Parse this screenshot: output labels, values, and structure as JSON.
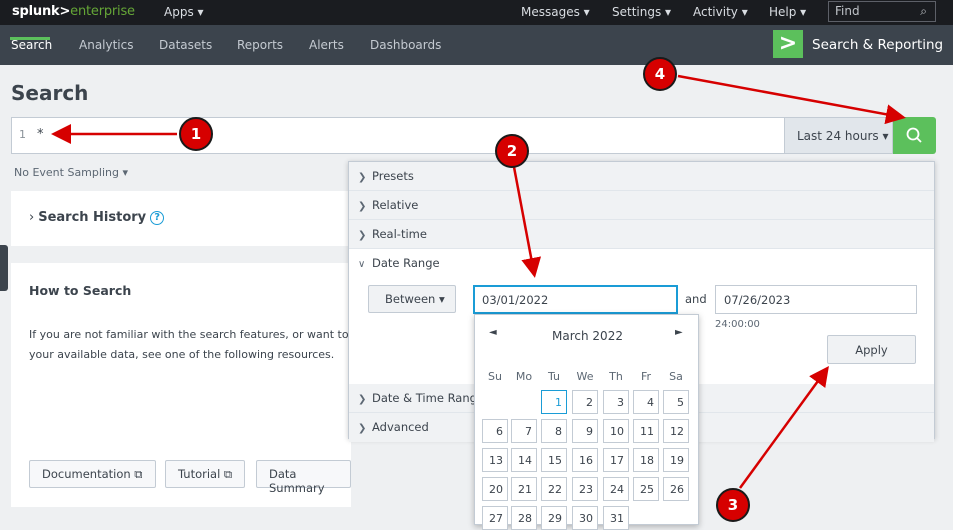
{
  "topbar": {
    "brand_main": "splunk>",
    "brand_sub": "enterprise",
    "apps": "Apps ▾",
    "messages": "Messages ▾",
    "settings": "Settings ▾",
    "activity": "Activity ▾",
    "help": "Help ▾",
    "find_placeholder": "Find"
  },
  "nav": {
    "items": [
      {
        "label": "Search"
      },
      {
        "label": "Analytics"
      },
      {
        "label": "Datasets"
      },
      {
        "label": "Reports"
      },
      {
        "label": "Alerts"
      },
      {
        "label": "Dashboards"
      }
    ],
    "app_name": "Search & Reporting"
  },
  "page": {
    "title": "Search",
    "line_number": "1",
    "query": "*",
    "time_range": "Last 24 hours ▾",
    "sampling": "No Event Sampling ▾",
    "history": "Search History",
    "howto_title": "How to Search",
    "howto_line1": "If you are not familiar with the search features, or want to l",
    "howto_line2": "your available data, see one of the following resources.",
    "resources": [
      {
        "label": "Documentation ⧉"
      },
      {
        "label": "Tutorial ⧉"
      },
      {
        "label": "Data Summary"
      }
    ]
  },
  "dropdown": {
    "presets": "Presets",
    "relative": "Relative",
    "realtime": "Real-time",
    "date_range": "Date Range",
    "between": "Between ▾",
    "start_date": "03/01/2022",
    "and": "and",
    "end_date": "07/26/2023",
    "end_time_hint": "24:00:00",
    "apply": "Apply",
    "date_time_range": "Date & Time Range",
    "advanced": "Advanced"
  },
  "calendar": {
    "month": "March 2022",
    "prev": "◄",
    "next": "►",
    "weekdays": [
      "Su",
      "Mo",
      "Tu",
      "We",
      "Th",
      "Fr",
      "Sa"
    ],
    "days": [
      "1",
      "2",
      "3",
      "4",
      "5",
      "6",
      "7",
      "8",
      "9",
      "10",
      "11",
      "12",
      "13",
      "14",
      "15",
      "16",
      "17",
      "18",
      "19",
      "20",
      "21",
      "22",
      "23",
      "24",
      "25",
      "26",
      "27",
      "28",
      "29",
      "30",
      "31"
    ],
    "selected": "1"
  },
  "markers": [
    "1",
    "2",
    "3",
    "4"
  ],
  "colors": {
    "accent_green": "#5cc05c",
    "marker_red": "#d60000",
    "focus_blue": "#1a9cd6"
  }
}
